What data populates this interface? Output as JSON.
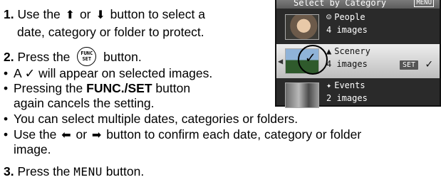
{
  "steps": {
    "s1_num": "1.",
    "s1_a": "Use the",
    "s1_or": "or",
    "s1_b": "button to select a",
    "s1_line2": "date, category or folder to protect.",
    "s2_num": "2.",
    "s2_a": "Press the",
    "s2_b": "button.",
    "func_top": "FUNC",
    "func_bottom": "SET",
    "b1": "A ✓ will appear on selected images.",
    "b2_a": "Pressing the",
    "b2_bold": "FUNC./SET",
    "b2_b": "button",
    "b2_line2": "again cancels the setting.",
    "b3": "You can select multiple dates, categories or folders.",
    "b4_a": "Use the",
    "b4_or": "or",
    "b4_b": "button to confirm each date, category or folder",
    "b4_line2": "image.",
    "s3_num": "3.",
    "s3_a": "Press the",
    "s3_menu": "MENU",
    "s3_b": "button."
  },
  "icons": {
    "up": "⬆",
    "down": "⬇",
    "left": "⬅",
    "right": "➡",
    "bullet": "•"
  },
  "screen": {
    "header_title": "Select by Category",
    "header_menu": "MENU",
    "rows": [
      {
        "icon": "☺",
        "category": "People",
        "count": "4 images"
      },
      {
        "icon": "▲",
        "category": "Scenery",
        "count": "4 images",
        "badge": "SET",
        "check": "✓"
      },
      {
        "icon": "✦",
        "category": "Events",
        "count": "2 images"
      }
    ],
    "circle_check": "✓",
    "nav_left": "◀",
    "nav_right": "▶"
  }
}
